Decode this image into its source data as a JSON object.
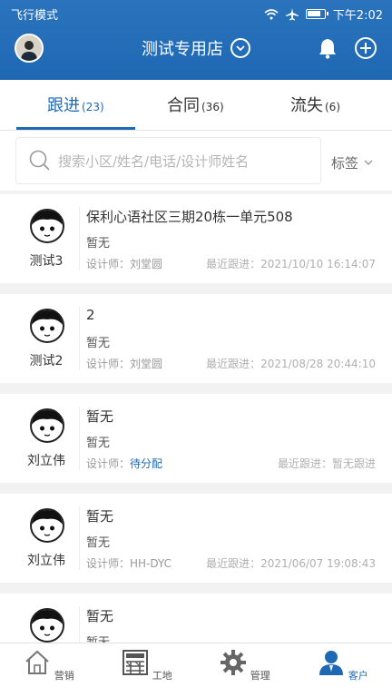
{
  "status_bar": {
    "left": "飞行模式",
    "time": "下午2:02"
  },
  "header": {
    "store_name": "测试专用店"
  },
  "tabs": [
    {
      "label": "跟进",
      "count": "(23)",
      "active": true
    },
    {
      "label": "合同",
      "count": "(36)",
      "active": false
    },
    {
      "label": "流失",
      "count": "(6)",
      "active": false
    }
  ],
  "search": {
    "placeholder": "搜索小区/姓名/电话/设计师姓名",
    "tag_label": "标签"
  },
  "customers": [
    {
      "owner": "测试3",
      "address": "保利心语社区三期20栋一单元508",
      "remark": "暂无",
      "designer_label": "设计师：",
      "designer": "刘堂圆",
      "follow": "最近跟进：2021/10/10 16:14:07"
    },
    {
      "owner": "测试2",
      "address": "2",
      "remark": "暂无",
      "designer_label": "设计师：",
      "designer": "刘堂圆",
      "follow": "最近跟进：2021/08/28 20:44:10"
    },
    {
      "owner": "刘立伟",
      "address": "暂无",
      "remark": "暂无",
      "designer_label": "设计师：",
      "designer": "待分配",
      "follow": "最近跟进：暂无跟进"
    },
    {
      "owner": "刘立伟",
      "address": "暂无",
      "remark": "暂无",
      "designer_label": "设计师：",
      "designer": "HH-DYC",
      "follow": "最近跟进：2021/06/07 19:08:43"
    },
    {
      "owner": "",
      "address": "暂无",
      "remark": "暂无",
      "designer_label": "",
      "designer": "",
      "follow": ""
    }
  ],
  "bottom_nav": [
    {
      "label": "营销",
      "icon": "house-icon"
    },
    {
      "label": "工地",
      "icon": "construction-icon"
    },
    {
      "label": "管理",
      "icon": "gear-icon"
    },
    {
      "label": "客户",
      "icon": "person-icon",
      "active": true
    }
  ],
  "colors": {
    "brand": "#1f68b3",
    "assigned_pending": "#1f68b3"
  }
}
